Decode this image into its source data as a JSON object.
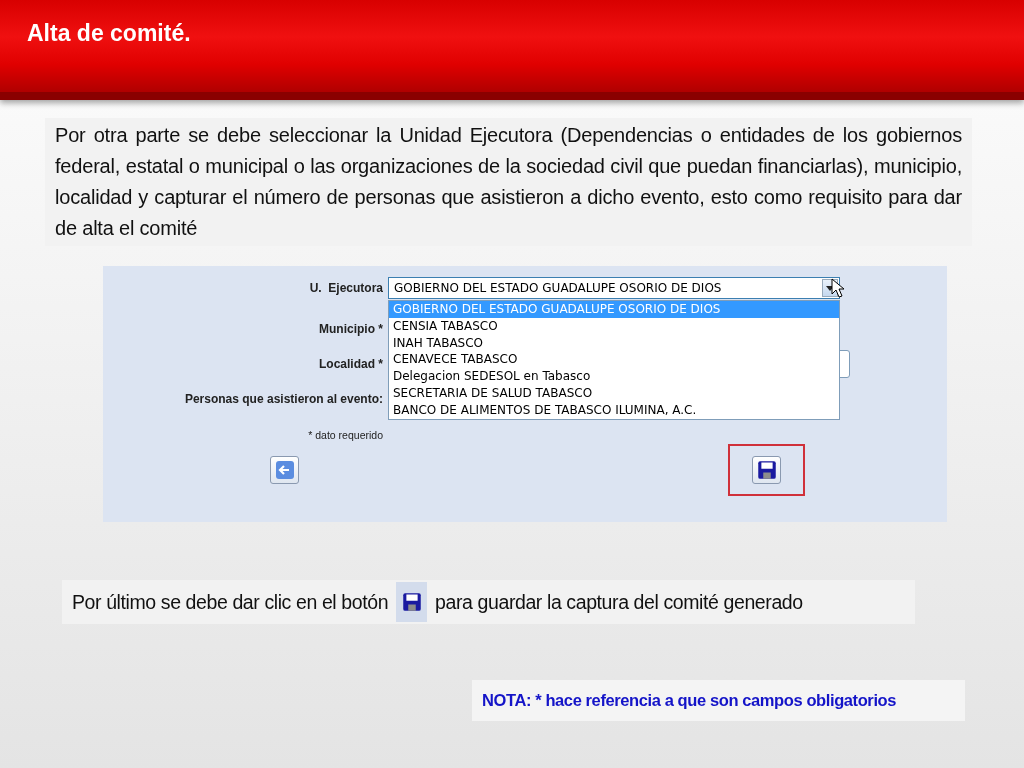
{
  "title": "Alta de comité.",
  "intro": "Por otra parte se debe seleccionar la Unidad Ejecutora (Dependencias o entidades de los gobiernos federal, estatal o municipal o las organizaciones de la sociedad civil que puedan financiarlas), municipio, localidad y capturar el número de personas que asistieron a dicho evento, esto como requisito para dar de alta el comité",
  "form": {
    "fields": [
      {
        "kind": "select",
        "label": "U.  Ejecutora",
        "value": "GOBIERNO DEL ESTADO GUADALUPE OSORIO DE DIOS",
        "expanded": true,
        "options": [
          {
            "label": "GOBIERNO DEL ESTADO GUADALUPE OSORIO DE DIOS",
            "selected": true
          },
          {
            "label": "CENSIA TABASCO",
            "selected": false
          },
          {
            "label": "INAH TABASCO",
            "selected": false
          },
          {
            "label": "CENAVECE TABASCO",
            "selected": false
          },
          {
            "label": "Delegacion SEDESOL en Tabasco",
            "selected": false
          },
          {
            "label": "SECRETARIA DE SALUD TABASCO",
            "selected": false
          },
          {
            "label": "BANCO DE ALIMENTOS DE TABASCO ILUMINA, A.C.",
            "selected": false
          }
        ]
      },
      {
        "kind": "hidden",
        "label": "Municipio *"
      },
      {
        "kind": "select",
        "label": "Localidad *"
      },
      {
        "kind": "hidden",
        "label": "Personas que asistieron al evento:"
      }
    ],
    "required_note": "* dato requerido"
  },
  "instruction": {
    "before": "Por último se debe dar clic en el botón",
    "after": "para guardar la captura del comité generado"
  },
  "note": "NOTA: * hace referencia a que son campos obligatorios"
}
